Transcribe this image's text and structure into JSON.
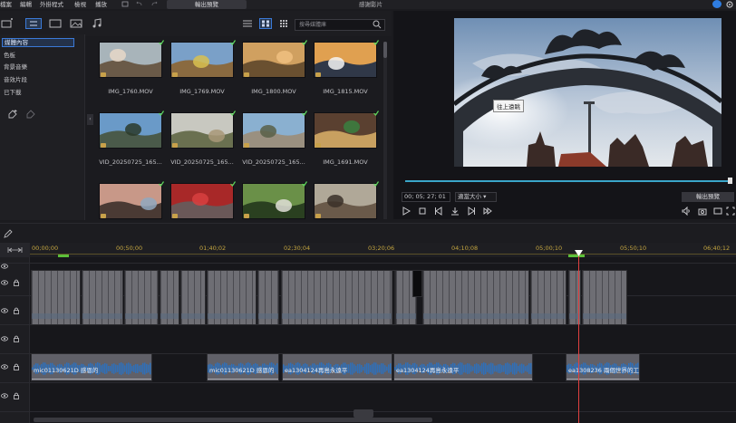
{
  "menu": {
    "items": [
      "檔案",
      "編輯",
      "外掛程式",
      "檢視",
      "播放"
    ],
    "export_preview": "輸出預覽",
    "project_title": "感謝影片"
  },
  "library": {
    "search_placeholder": "搜尋媒體庫",
    "sidebar": [
      "媒體內容",
      "色板",
      "背景音樂",
      "音效片段",
      "已下載"
    ],
    "media": [
      {
        "label": "IMG_1760.MOV"
      },
      {
        "label": "IMG_1769.MOV"
      },
      {
        "label": "IMG_1800.MOV"
      },
      {
        "label": "IMG_1815.MOV"
      },
      {
        "label": "VID_20250725_165..."
      },
      {
        "label": "VID_20250725_165..."
      },
      {
        "label": "VID_20250725_165..."
      },
      {
        "label": "IMG_1691.MOV"
      },
      {
        "label": ""
      },
      {
        "label": ""
      },
      {
        "label": ""
      },
      {
        "label": ""
      }
    ]
  },
  "preview": {
    "caption": "往上遠眺",
    "timecode": "00; 05; 27; 01",
    "fit_label": "適當大小",
    "export_frame": "輸出預覽"
  },
  "timeline": {
    "ruler": [
      "00;00;00",
      "00;50;00",
      "01;40;02",
      "02;30;04",
      "03;20;06",
      "04;10;08",
      "05;00;10",
      "05;50;10",
      "06;40;12"
    ],
    "audio_clips": [
      "mic01130621D 感恩的",
      "mic01130621D 感恩的",
      "ea1304124再島永遠平",
      "ea1304124再島永遠平",
      "ea1308236 兩個世界的工"
    ]
  },
  "colors": {
    "accent": "#3b7ad8",
    "playhead": "#e04040",
    "ruler_text": "#c4a640",
    "waveform": "#2f6fb8",
    "scrub": "#3aa6c8"
  }
}
